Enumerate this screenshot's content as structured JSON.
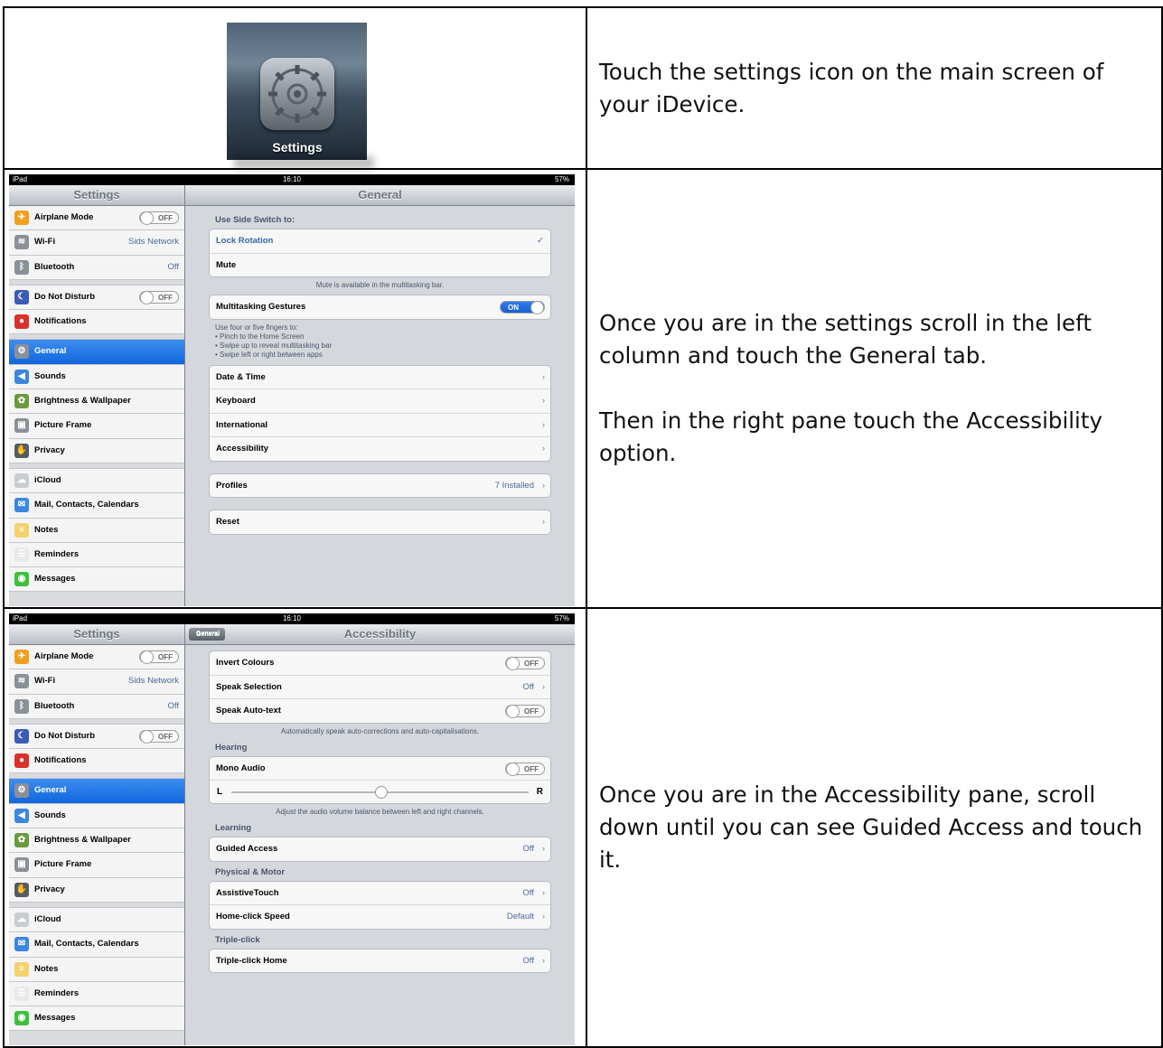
{
  "step1": {
    "icon_label": "Settings",
    "text": [
      "Touch the settings icon on the main screen of your iDevice."
    ]
  },
  "step2": {
    "status": {
      "left": "iPad",
      "time": "16:10",
      "battery": "57%"
    },
    "master_title": "Settings",
    "detail_title": "General",
    "text": [
      "Once you are in the settings scroll in the left column and touch the General tab.",
      "Then in the right pane touch the Accessibility option."
    ],
    "general": {
      "side_switch_header": "Use Side Switch to:",
      "lock_rotation": "Lock Rotation",
      "mute": "Mute",
      "mute_footer": "Mute is available in the multitasking bar.",
      "multitasking": "Multitasking Gestures",
      "multitasking_toggle": "ON",
      "multitasking_footer": [
        "Use four or five fingers to:",
        "• Pinch to the Home Screen",
        "• Swipe up to reveal multitasking bar",
        "• Swipe left or right between apps"
      ],
      "date_time": "Date & Time",
      "keyboard": "Keyboard",
      "international": "International",
      "accessibility": "Accessibility",
      "profiles": "Profiles",
      "profiles_value": "7 Installed",
      "reset": "Reset"
    }
  },
  "step3": {
    "status": {
      "left": "iPad",
      "time": "16:10",
      "battery": "57%"
    },
    "master_title": "Settings",
    "back_label": "General",
    "detail_title": "Accessibility",
    "text": [
      "Once you are in the Accessibility pane, scroll down until you can see Guided Access and touch it."
    ],
    "accessibility": {
      "invert": "Invert Colours",
      "invert_toggle": "OFF",
      "speak_selection": "Speak Selection",
      "speak_selection_value": "Off",
      "speak_autotext": "Speak Auto-text",
      "speak_autotext_toggle": "OFF",
      "autotext_footer": "Automatically speak auto-corrections and auto-capitalisations.",
      "hearing_header": "Hearing",
      "mono_audio": "Mono Audio",
      "mono_audio_toggle": "OFF",
      "balance_left": "L",
      "balance_right": "R",
      "balance_value": 0.5,
      "balance_footer": "Adjust the audio volume balance between left and right channels.",
      "learning_header": "Learning",
      "guided_access": "Guided Access",
      "guided_access_value": "Off",
      "motor_header": "Physical & Motor",
      "assistive_touch": "AssistiveTouch",
      "assistive_touch_value": "Off",
      "home_click_speed": "Home-click Speed",
      "home_click_speed_value": "Default",
      "triple_header": "Triple-click",
      "triple_home": "Triple-click Home",
      "triple_home_value": "Off"
    }
  },
  "sidebar": [
    {
      "label": "Airplane Mode",
      "toggle": "OFF",
      "icon": "airplane-icon",
      "color": "#f0a01e"
    },
    {
      "label": "Wi-Fi",
      "value": "Sids Network",
      "icon": "wifi-icon",
      "color": "#8a9099"
    },
    {
      "label": "Bluetooth",
      "value": "Off",
      "icon": "bluetooth-icon",
      "color": "#8a9099"
    },
    {
      "label": "Do Not Disturb",
      "toggle": "OFF",
      "icon": "moon-icon",
      "color": "#3b5bb5"
    },
    {
      "label": "Notifications",
      "icon": "notifications-icon",
      "color": "#d9312b"
    },
    {
      "label": "General",
      "icon": "gear-icon",
      "color": "#8a9099",
      "selected": true
    },
    {
      "label": "Sounds",
      "icon": "speaker-icon",
      "color": "#3d86e0"
    },
    {
      "label": "Brightness & Wallpaper",
      "icon": "flower-icon",
      "color": "#6a9a3e"
    },
    {
      "label": "Picture Frame",
      "icon": "picture-frame-icon",
      "color": "#8a9099"
    },
    {
      "label": "Privacy",
      "icon": "hand-icon",
      "color": "#555b63"
    },
    {
      "label": "iCloud",
      "icon": "cloud-icon",
      "color": "#c9ccd1"
    },
    {
      "label": "Mail, Contacts, Calendars",
      "icon": "mail-icon",
      "color": "#3d86e0"
    },
    {
      "label": "Notes",
      "icon": "notes-icon",
      "color": "#f2d36b"
    },
    {
      "label": "Reminders",
      "icon": "reminders-icon",
      "color": "#e9e9e9"
    },
    {
      "label": "Messages",
      "icon": "messages-icon",
      "color": "#3fbf3c"
    }
  ]
}
